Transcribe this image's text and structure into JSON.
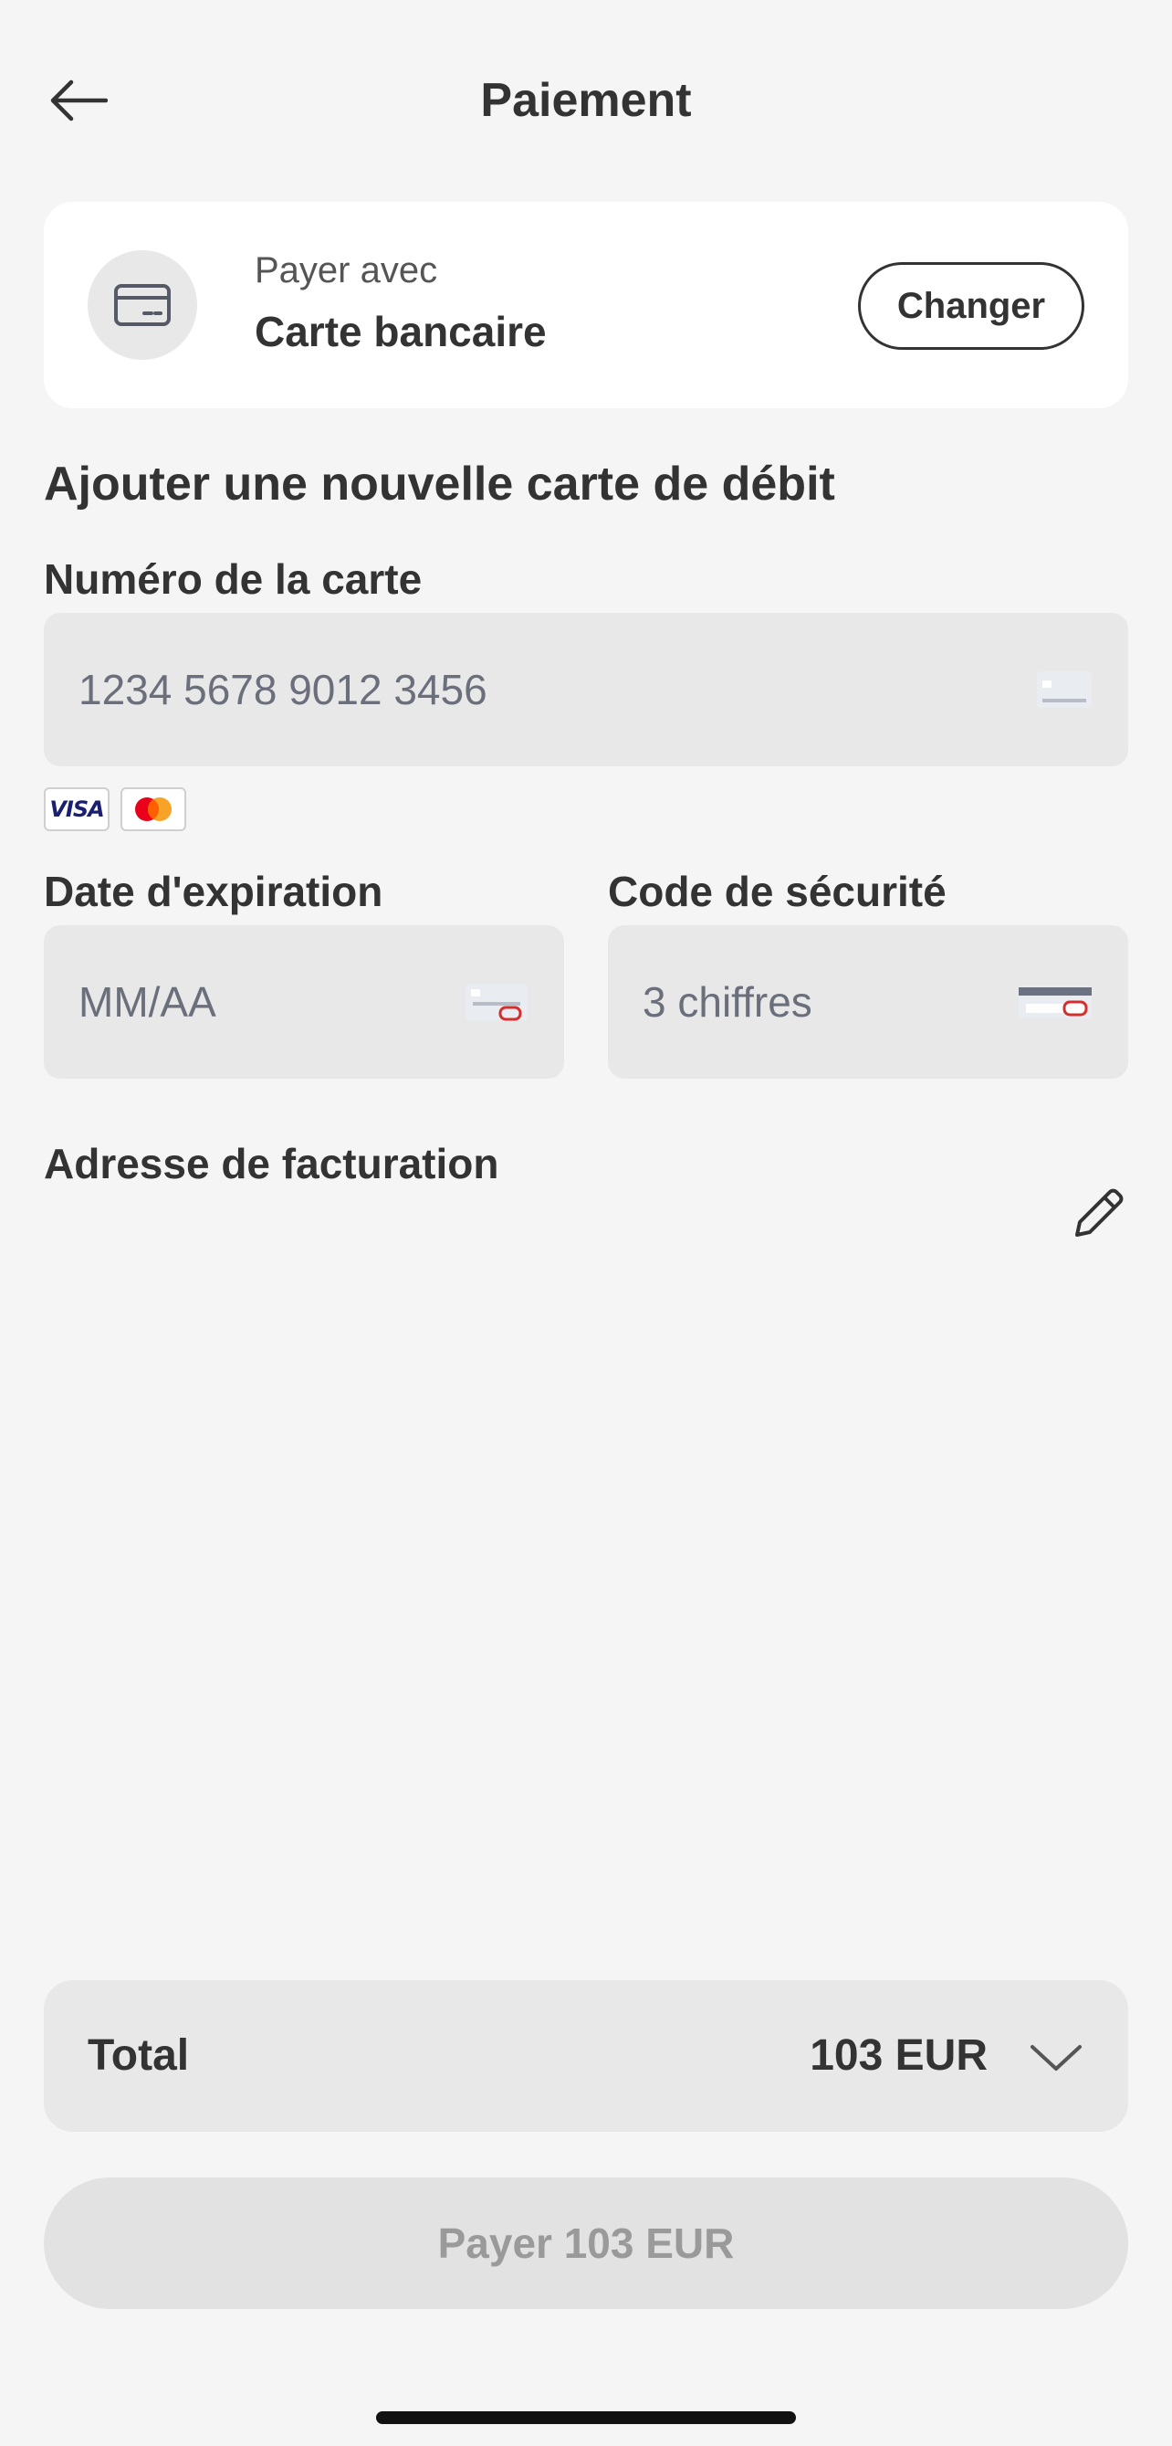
{
  "header": {
    "title": "Paiement",
    "back_icon": "arrow-left-icon"
  },
  "pay_with": {
    "label": "Payer avec",
    "method": "Carte bancaire",
    "change_label": "Changer",
    "icon": "credit-card-icon"
  },
  "new_card": {
    "section_title": "Ajouter une nouvelle carte de débit",
    "card_number": {
      "label": "Numéro de la carte",
      "placeholder": "1234 5678 9012 3456",
      "value": ""
    },
    "brands": [
      "VISA",
      "Mastercard"
    ],
    "expiry": {
      "label": "Date d'expiration",
      "placeholder": "MM/AA",
      "value": ""
    },
    "security_code": {
      "label": "Code de sécurité",
      "placeholder": "3 chiffres",
      "value": ""
    }
  },
  "billing": {
    "label": "Adresse de facturation",
    "edit_icon": "pencil-icon"
  },
  "total": {
    "label": "Total",
    "amount": "103 EUR",
    "expand_icon": "chevron-down-icon"
  },
  "pay_button": {
    "label": "Payer 103 EUR"
  },
  "colors": {
    "background": "#f5f5f5",
    "card": "#ffffff",
    "input": "#e8e8e8",
    "text": "#333333",
    "disabled_text": "#9a9a9a",
    "visa_blue": "#1a1f71",
    "mastercard_red": "#eb001b",
    "mastercard_orange": "#f79e1b"
  }
}
